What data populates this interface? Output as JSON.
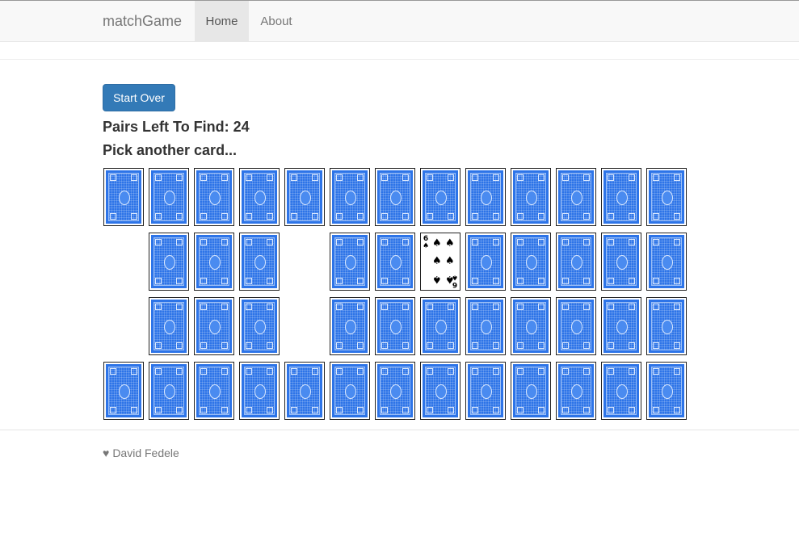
{
  "navbar": {
    "brand": "matchGame",
    "items": [
      {
        "label": "Home",
        "active": true
      },
      {
        "label": "About",
        "active": false
      }
    ]
  },
  "game": {
    "start_over_label": "Start Over",
    "pairs_left_text": "Pairs Left To Find: 24",
    "status_text": "Pick another card...",
    "board": [
      [
        "back",
        "back",
        "back",
        "back",
        "back",
        "back",
        "back",
        "back",
        "back",
        "back",
        "back",
        "back",
        "back"
      ],
      [
        "empty",
        "back",
        "back",
        "back",
        "empty",
        "back",
        "back",
        "face",
        "back",
        "back",
        "back",
        "back",
        "back"
      ],
      [
        "empty",
        "back",
        "back",
        "back",
        "empty",
        "back",
        "back",
        "back",
        "back",
        "back",
        "back",
        "back",
        "back"
      ],
      [
        "back",
        "back",
        "back",
        "back",
        "back",
        "back",
        "back",
        "back",
        "back",
        "back",
        "back",
        "back",
        "back"
      ]
    ],
    "revealed_card": {
      "rank": "6",
      "suit": "♠",
      "suit_name": "spades"
    },
    "card_back_color": "#2d74e8"
  },
  "footer": {
    "icon": "heart-icon",
    "author": "David Fedele"
  }
}
